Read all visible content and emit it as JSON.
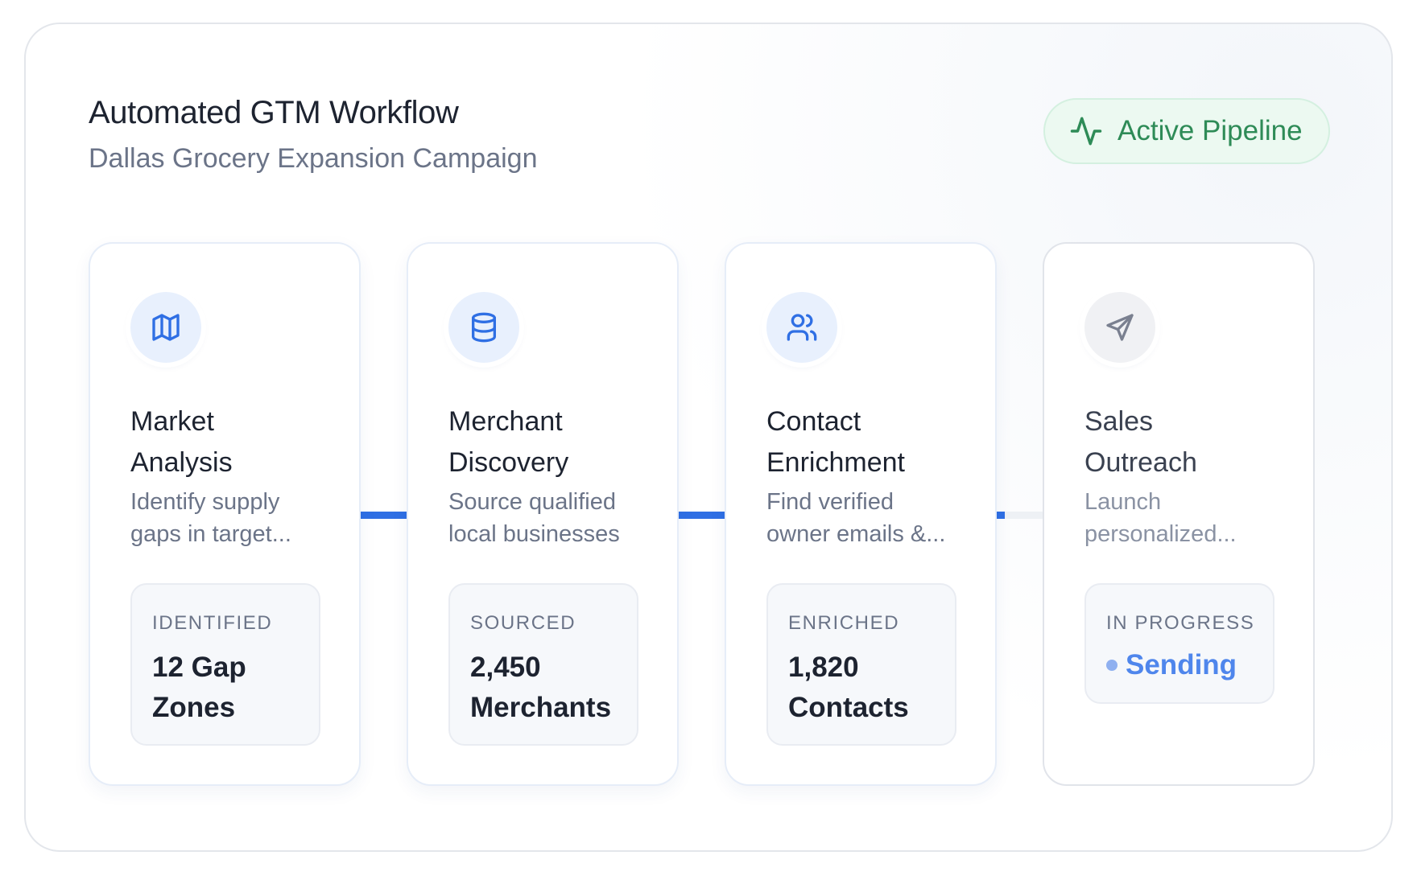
{
  "header": {
    "title": "Automated GTM Workflow",
    "subtitle": "Dallas Grocery Expansion Campaign"
  },
  "status_badge": {
    "label": "Active Pipeline",
    "icon": "activity-icon",
    "color": "#2e8b57"
  },
  "colors": {
    "accent": "#2f6fe4",
    "status_green": "#2e8b57",
    "connector_inactive": "#eef1f5"
  },
  "steps": [
    {
      "icon": "map-icon",
      "title_lines": [
        "Market",
        "Analysis"
      ],
      "desc_lines": [
        "Identify supply",
        "gaps in target..."
      ],
      "stat_label": "IDENTIFIED",
      "stat_value_lines": [
        "12 Gap",
        "Zones"
      ]
    },
    {
      "icon": "database-icon",
      "title_lines": [
        "Merchant",
        "Discovery"
      ],
      "desc_lines": [
        "Source qualified",
        "local businesses"
      ],
      "stat_label": "SOURCED",
      "stat_value_lines": [
        "2,450",
        "Merchants"
      ]
    },
    {
      "icon": "users-icon",
      "title_lines": [
        "Contact",
        "Enrichment"
      ],
      "desc_lines": [
        "Find verified",
        "owner emails &..."
      ],
      "stat_label": "ENRICHED",
      "stat_value_lines": [
        "1,820",
        "Contacts"
      ]
    },
    {
      "icon": "send-icon",
      "title_lines": [
        "Sales",
        "Outreach"
      ],
      "desc_lines": [
        "Launch",
        "personalized..."
      ],
      "stat_label": "IN PROGRESS",
      "status_text": "Sending"
    }
  ]
}
